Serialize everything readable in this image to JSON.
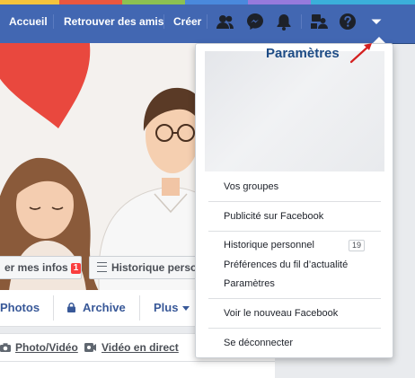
{
  "nav": {
    "links": [
      "Accueil",
      "Retrouver des amis",
      "Créer"
    ],
    "icons": [
      "friends-icon",
      "messenger-icon",
      "notifications-icon",
      "groups-icon",
      "help-icon",
      "account-dropdown-icon"
    ]
  },
  "profile": {
    "cover_buttons": {
      "update_info": "er mes infos",
      "update_info_badge": "1",
      "activity_log": "Historique personn"
    },
    "tabs": [
      "Photos",
      "Archive",
      "Plus"
    ],
    "composer": {
      "photo_video": "Photo/Vidéo",
      "live_video": "Vidéo en direct"
    }
  },
  "menu": {
    "items": [
      {
        "label": "Vos groupes"
      },
      {
        "label": "Publicité sur Facebook"
      },
      {
        "label": "Historique personnel",
        "badge": "19"
      },
      {
        "label": "Préférences du fil d’actualité"
      },
      {
        "label": "Paramètres"
      },
      {
        "label": "Voir le nouveau Facebook"
      },
      {
        "label": "Se déconnecter"
      }
    ]
  },
  "annotation": {
    "text": "Paramètres"
  },
  "colors": {
    "brand": "#4267b2",
    "link": "#385898",
    "badge": "#fa3e3e",
    "annotation_arrow": "#d42020"
  }
}
